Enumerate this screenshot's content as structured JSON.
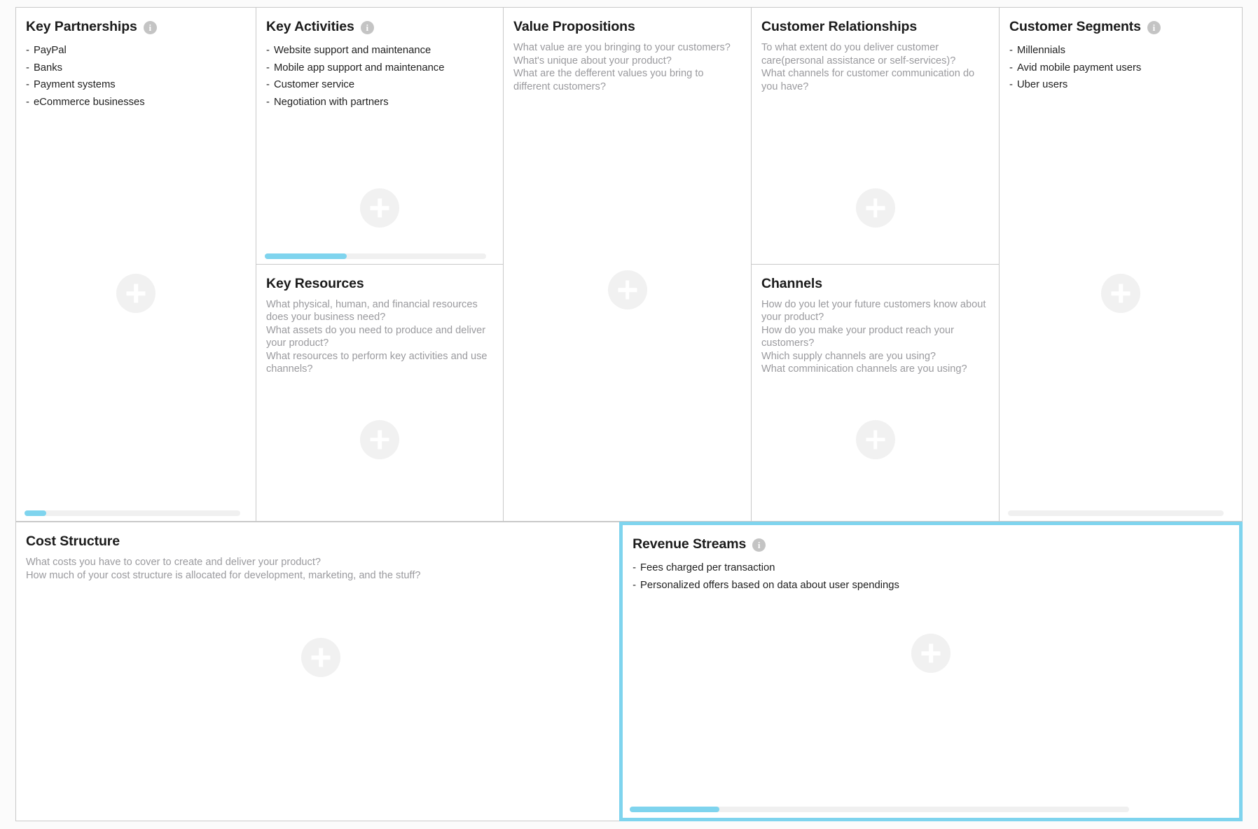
{
  "blocks": {
    "key_partnerships": {
      "title": "Key Partnerships",
      "info_icon": "info-icon",
      "items": [
        "PayPal",
        "Banks",
        "Payment systems",
        "eCommerce businesses"
      ],
      "add_icon": "plus-icon",
      "scrollbar": {
        "thumb_percent": 10
      }
    },
    "key_activities": {
      "title": "Key Activities",
      "info_icon": "info-icon",
      "items": [
        "Website support and maintenance",
        "Mobile app support and maintenance",
        "Customer service",
        "Negotiation with partners"
      ],
      "add_icon": "plus-icon",
      "scrollbar": {
        "thumb_percent": 37
      }
    },
    "key_resources": {
      "title": "Key Resources",
      "hint": "What physical, human, and financial resources does your business need?\nWhat assets do you need to produce and deliver your product?\nWhat resources to perform key activities and use channels?",
      "add_icon": "plus-icon"
    },
    "value_propositions": {
      "title": "Value Propositions",
      "hint": "What value are you bringing to your customers?\nWhat's unique about your product?\nWhat are the defferent values you bring to different customers?",
      "add_icon": "plus-icon"
    },
    "customer_relationships": {
      "title": "Customer Relationships",
      "hint": "To what extent do you deliver customer care(personal assistance or self-services)?\nWhat channels for customer communication do you have?",
      "add_icon": "plus-icon"
    },
    "channels": {
      "title": "Channels",
      "hint": "How do you let your future customers know about your product?\nHow do you make your product reach your customers?\nWhich supply channels are you using?\nWhat comminication channels are you using?",
      "add_icon": "plus-icon"
    },
    "customer_segments": {
      "title": "Customer Segments",
      "info_icon": "info-icon",
      "items": [
        "Millennials",
        "Avid mobile payment users",
        "Uber users"
      ],
      "add_icon": "plus-icon",
      "scrollbar": {
        "thumb_percent": 0
      }
    },
    "cost_structure": {
      "title": "Cost Structure",
      "hint": "What costs you have to cover to create and deliver your product?\nHow much of your cost structure is allocated for development, marketing, and the stuff?",
      "add_icon": "plus-icon"
    },
    "revenue_streams": {
      "title": "Revenue Streams",
      "info_icon": "info-icon",
      "items": [
        "Fees charged per transaction",
        "Personalized offers based on data about user spendings"
      ],
      "add_icon": "plus-icon",
      "scrollbar": {
        "thumb_percent": 18
      },
      "selected": true
    }
  },
  "colors": {
    "accent": "#7fd4ee",
    "border": "#c9c9c9",
    "hint_text": "#9a9a9e",
    "body_text": "#1f1f1f",
    "plus_circle": "#f1f1f1",
    "scroll_track": "#f0f0f0"
  }
}
